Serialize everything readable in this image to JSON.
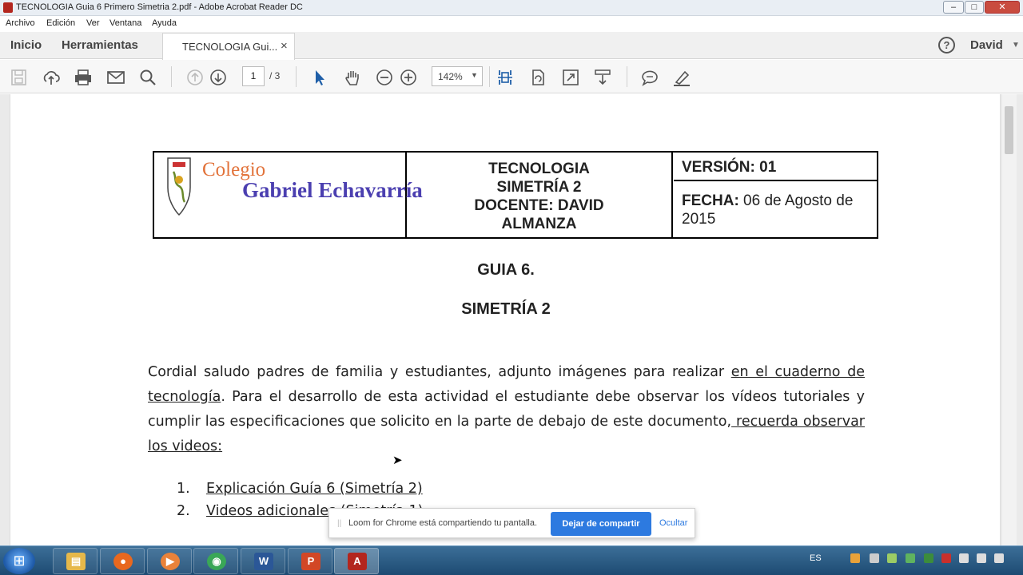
{
  "window": {
    "title": "TECNOLOGIA  Guia 6 Primero Simetria 2.pdf - Adobe Acrobat Reader DC",
    "min": "–",
    "max": "□",
    "close": "✕"
  },
  "menu": [
    "Archivo",
    "Edición",
    "Ver",
    "Ventana",
    "Ayuda"
  ],
  "tabs": {
    "home": "Inicio",
    "tools": "Herramientas",
    "doc": "TECNOLOGIA  Gui...",
    "close": "×"
  },
  "user": {
    "help": "?",
    "name": "David",
    "caret": "▼"
  },
  "toolbar": {
    "page_current": "1",
    "page_total": "/  3",
    "zoom": "142%",
    "zoom_caret": "▼"
  },
  "document": {
    "logo_line1": "Colegio",
    "logo_line2": "Gabriel Echavarría",
    "header_center": [
      "TECNOLOGIA",
      "SIMETRÍA 2",
      "DOCENTE: DAVID",
      "ALMANZA"
    ],
    "version": "VERSIÓN: 01",
    "fecha_label": "FECHA:",
    "fecha_value": " 06 de Agosto de 2015",
    "title1": "GUIA 6.",
    "title2": "SIMETRÍA 2",
    "para_a": "Cordial saludo padres de familia y estudiantes, adjunto imágenes para realizar ",
    "para_u1": "en el cuaderno de tecnología",
    "para_b": ".   Para el desarrollo de esta actividad el estudiante debe observar los vídeos tutoriales y cumplir las especificaciones que solicito en la parte de debajo de este documento,",
    "para_u2": " recuerda observar los videos:",
    "list": [
      {
        "num": "1.",
        "text": "Explicación Guía 6 (Simetría 2)"
      },
      {
        "num": "2.",
        "text": " Videos adicionales (Simetría 1)"
      }
    ]
  },
  "loom": {
    "grip": "||",
    "message": "Loom for Chrome está compartiendo tu pantalla.",
    "stop": "Dejar de compartir",
    "hide": "Ocultar"
  },
  "taskbar": {
    "start": "⊞",
    "apps": [
      {
        "name": "explorer",
        "glyph": "▤",
        "color": "#e6b84a"
      },
      {
        "name": "firefox",
        "glyph": "●",
        "color": "#e8681f"
      },
      {
        "name": "media-player",
        "glyph": "▶",
        "color": "#e9823a"
      },
      {
        "name": "chrome",
        "glyph": "◉",
        "color": "#3aa757"
      },
      {
        "name": "word",
        "glyph": "W",
        "color": "#2b5797"
      },
      {
        "name": "powerpoint",
        "glyph": "P",
        "color": "#d24726"
      },
      {
        "name": "acrobat",
        "glyph": "A",
        "color": "#b3261e"
      }
    ],
    "lang": "ES"
  }
}
